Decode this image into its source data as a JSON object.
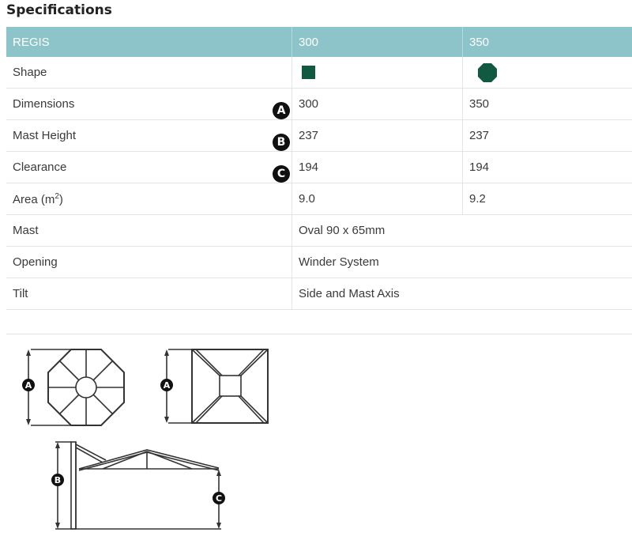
{
  "title": "Specifications",
  "header": {
    "label": "REGIS",
    "col1": "300",
    "col2": "350"
  },
  "rows": [
    {
      "label": "Shape",
      "col1": "",
      "col2": ""
    },
    {
      "label": "Dimensions",
      "badge": "A",
      "col1": "300",
      "col2": "350"
    },
    {
      "label": "Mast Height",
      "badge": "B",
      "col1": "237",
      "col2": "237"
    },
    {
      "label": "Clearance",
      "badge": "C",
      "col1": "194",
      "col2": "194"
    },
    {
      "label": "Area (m",
      "sup": "2",
      "label_end": ")",
      "col1": "9.0",
      "col2": "9.2"
    },
    {
      "label": "Mast",
      "span": "Oval 90 x 65mm"
    },
    {
      "label": "Opening",
      "span": "Winder System"
    },
    {
      "label": "Tilt",
      "span": "Side and Mast Axis"
    }
  ],
  "icons": {
    "shape_col1": "square-icon",
    "shape_col2": "octagon-icon"
  },
  "colors": {
    "header_bg": "#8cc4ca",
    "shape_green": "#0f5a40"
  },
  "diagram": {
    "marker_a": "A",
    "marker_b": "B",
    "marker_c": "C"
  }
}
